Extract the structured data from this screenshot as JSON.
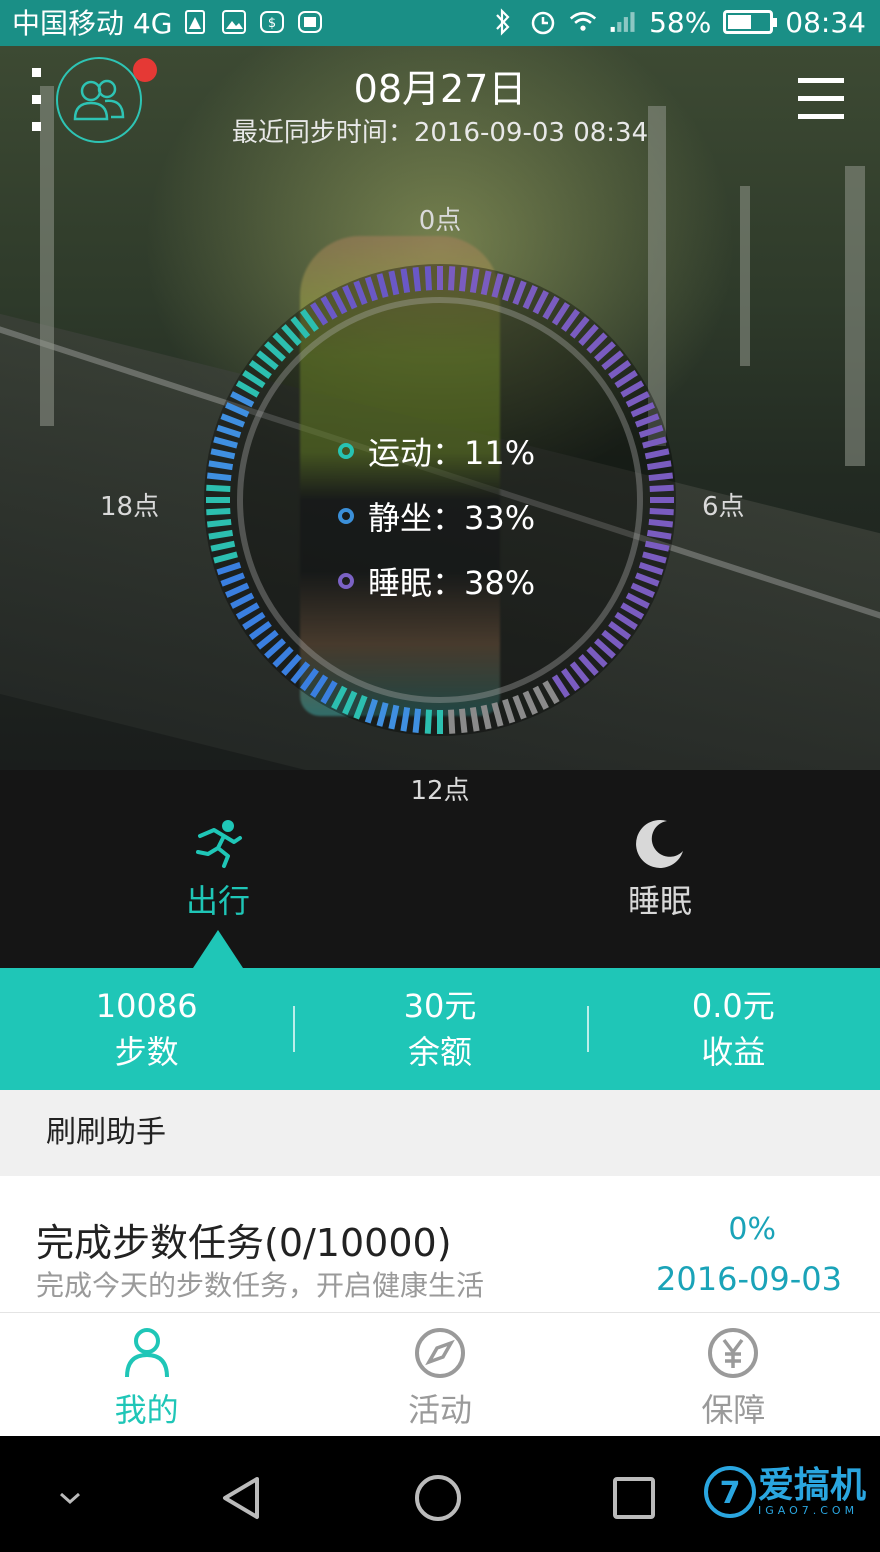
{
  "status_bar": {
    "carrier": "中国移动 4G",
    "battery_text": "58%",
    "battery_level": 0.58,
    "time": "08:34",
    "icons": [
      "sim-alert-icon",
      "gallery-icon",
      "money-app-icon",
      "wallet-app-icon",
      "bluetooth-icon",
      "alarm-icon",
      "wifi-icon",
      "signal-4g-icon",
      "battery-icon"
    ]
  },
  "header": {
    "date": "08月27日",
    "sync_text": "最近同步时间：2016-09-03 08:34",
    "has_notification": true
  },
  "clock_labels": {
    "top": "0点",
    "right": "6点",
    "bottom": "12点",
    "left": "18点"
  },
  "activity_stats": [
    {
      "label": "运动：11%",
      "color": "#27c3b2"
    },
    {
      "label": "静坐：33%",
      "color": "#3b8fd8"
    },
    {
      "label": "睡眠：38%",
      "color": "#7b62c4"
    }
  ],
  "mode_tabs": [
    {
      "label": "出行",
      "icon": "running-icon",
      "active": true,
      "color": "#1fc6b7"
    },
    {
      "label": "睡眠",
      "icon": "moon-icon",
      "active": false,
      "color": "#d8d8d8"
    }
  ],
  "summary": [
    {
      "value": "10086",
      "label": "步数"
    },
    {
      "value": "30元",
      "label": "余额"
    },
    {
      "value": "0.0元",
      "label": "收益"
    }
  ],
  "helper": {
    "title": "刷刷助手",
    "task_title": "完成步数任务(0/10000)",
    "task_desc": "完成今天的步数任务，开启健康生活",
    "task_percent": "0%",
    "task_date": "2016-09-03"
  },
  "bottom_nav": [
    {
      "label": "我的",
      "icon": "person-icon",
      "active": true
    },
    {
      "label": "活动",
      "icon": "compass-icon",
      "active": false
    },
    {
      "label": "保障",
      "icon": "yuan-icon",
      "active": false
    }
  ],
  "watermark": {
    "brand": "爱搞机",
    "sub": "IGAO7.COM",
    "logo": "7"
  },
  "colors": {
    "accent": "#1fc6b7",
    "status_bar": "#1a8f86",
    "link": "#1aa3b8"
  }
}
